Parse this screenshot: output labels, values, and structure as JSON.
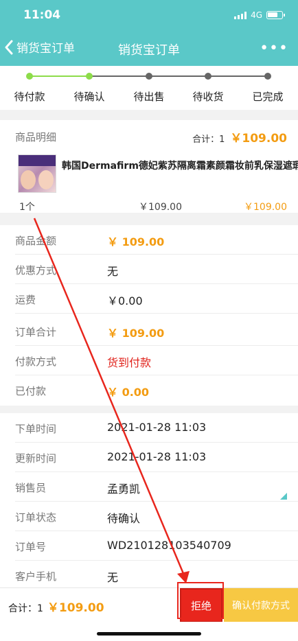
{
  "status": {
    "time": "11:04",
    "network": "4G"
  },
  "nav": {
    "back_label": "销货宝订单",
    "title": "销货宝订单",
    "more": "•••"
  },
  "steps": [
    "待付款",
    "待确认",
    "待出售",
    "待收货",
    "已完成"
  ],
  "product": {
    "header": "商品明细",
    "total_label": "合计：1",
    "total_amount": "￥109.00",
    "name": "韩国Dermafirm德妃紫苏隔离霜素颜霜妆前乳保湿遮瑕",
    "qty": "1个",
    "price": "￥109.00",
    "subtotal": "￥109.00"
  },
  "amounts": [
    {
      "key": "商品金额",
      "value": "￥ 109.00",
      "style": "orange"
    },
    {
      "key": "优惠方式",
      "value": "无",
      "style": ""
    },
    {
      "key": "运费",
      "value": "￥0.00",
      "style": ""
    },
    {
      "key": "订单合计",
      "value": "￥ 109.00",
      "style": "orange"
    },
    {
      "key": "付款方式",
      "value": "货到付款",
      "style": "red"
    },
    {
      "key": "已付款",
      "value": "￥ 0.00",
      "style": "orange"
    }
  ],
  "info": [
    {
      "key": "下单时间",
      "value": "2021-01-28 11:03"
    },
    {
      "key": "更新时间",
      "value": "2021-01-28 11:03"
    },
    {
      "key": "销售员",
      "value": "孟勇凯"
    },
    {
      "key": "订单状态",
      "value": "待确认"
    },
    {
      "key": "订单号",
      "value": "WD210128103540709"
    },
    {
      "key": "客户手机",
      "value": "无"
    }
  ],
  "bottom": {
    "total_label": "合计：1",
    "total_amount": "￥109.00",
    "reject_label": "拒绝",
    "confirm_label": "确认付款方式"
  },
  "colors": {
    "header": "#5ac8c8",
    "step_done": "#8ddc4a",
    "step_todo": "#666666",
    "accent": "#f39c12",
    "reject": "#e8261d",
    "confirm": "#f7c843"
  }
}
